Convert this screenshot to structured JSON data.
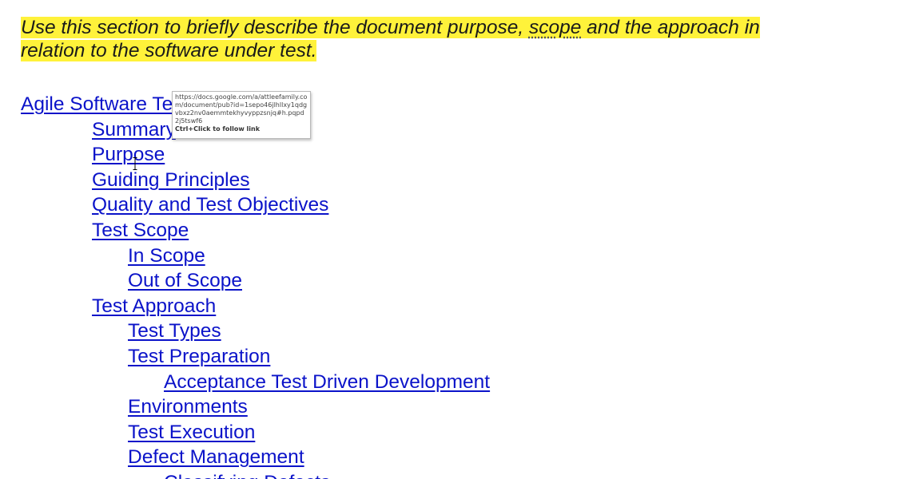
{
  "intro": {
    "line1_before": "Use this section to briefly describe the document purpose, ",
    "line1_spell": "scope",
    "line1_after": " and the approach in",
    "line2": "relation to the software under test."
  },
  "toc": [
    {
      "label": "Agile Software Test Plan",
      "level": 0
    },
    {
      "label": "Summary",
      "level": 1
    },
    {
      "label": "Purpose",
      "level": 1
    },
    {
      "label": "Guiding Principles",
      "level": 1
    },
    {
      "label": "Quality and Test Objectives",
      "level": 1
    },
    {
      "label": "Test Scope",
      "level": 1
    },
    {
      "label": "In Scope",
      "level": 2
    },
    {
      "label": "Out of Scope",
      "level": 2
    },
    {
      "label": "Test Approach",
      "level": 1
    },
    {
      "label": "Test Types",
      "level": 2
    },
    {
      "label": "Test Preparation",
      "level": 2
    },
    {
      "label": "Acceptance Test Driven Development",
      "level": 3
    },
    {
      "label": "Environments",
      "level": 2
    },
    {
      "label": "Test Execution",
      "level": 2
    },
    {
      "label": "Defect Management",
      "level": 2
    },
    {
      "label": "Classifying Defects",
      "level": 3
    }
  ],
  "tooltip": {
    "url": "https://docs.google.com/a/attleefamily.com/document/pub?id=1sepo46jlhllxy1qdgvbxz2nv0aemmtekhyvyppzsnjq#h.pqpd2j5tswf6",
    "hint": "Ctrl+Click to follow link"
  },
  "colors": {
    "link": "#0b13c9",
    "highlight": "#fff23a"
  }
}
